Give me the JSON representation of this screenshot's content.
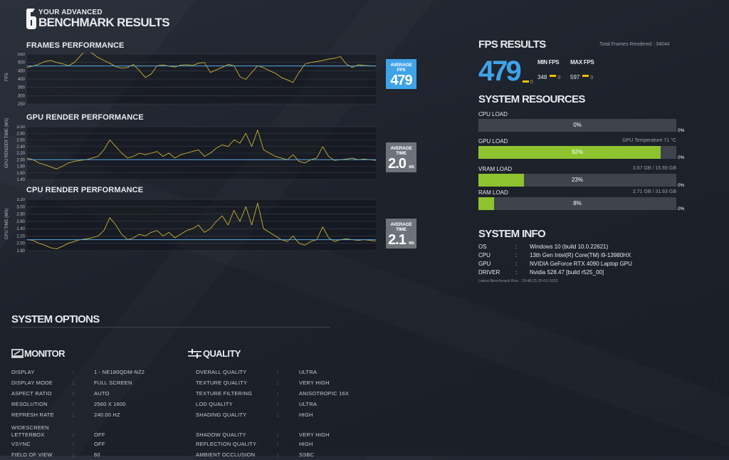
{
  "header": {
    "logo_number": "6",
    "title_line1": "YOUR ADVANCED",
    "title_line2": "BENCHMARK RESULTS"
  },
  "frames_chart": {
    "title": "FRAMES PERFORMANCE",
    "ylabel": "FPS",
    "ticks": [
      "550",
      "500",
      "450",
      "400",
      "350",
      "300",
      "250"
    ],
    "avg_label": "AVERAGE FPS",
    "avg_value": "479",
    "avg_unit": ""
  },
  "gpu_chart": {
    "title": "GPU RENDER PERFORMANCE",
    "ylabel": "GPU RENDER TIME (MS)",
    "ticks": [
      "3.00",
      "2.80",
      "2.60",
      "2.40",
      "2.20",
      "2.00",
      "1.80",
      "1.60",
      "1.40"
    ],
    "avg_label": "AVERAGE TIME",
    "avg_value": "2.0",
    "avg_unit": "MS"
  },
  "cpu_chart": {
    "title": "CPU RENDER PERFORMANCE",
    "ylabel": "CPU TIME (MS)",
    "ticks": [
      "3.20",
      "3.00",
      "2.80",
      "2.60",
      "2.40",
      "2.20",
      "2.00",
      "1.80"
    ],
    "avg_label": "AVERAGE TIME",
    "avg_value": "2.1",
    "avg_unit": "MS"
  },
  "chart_data": [
    {
      "type": "line",
      "title": "FRAMES PERFORMANCE",
      "ylabel": "FPS",
      "ylim": [
        250,
        550
      ],
      "x": [
        0,
        1,
        2,
        3,
        4,
        5,
        6,
        7,
        8,
        9,
        10,
        11,
        12,
        13,
        14,
        15,
        16,
        17,
        18,
        19,
        20,
        21,
        22,
        23,
        24,
        25,
        26,
        27,
        28,
        29,
        30,
        31,
        32,
        33,
        34,
        35,
        36,
        37,
        38,
        39,
        40,
        41,
        42,
        43,
        44,
        45,
        46,
        47,
        48,
        49,
        50,
        51,
        52,
        53,
        54,
        55,
        56,
        57,
        58,
        59
      ],
      "series": [
        {
          "values": [
            470,
            478,
            490,
            505,
            512,
            500,
            492,
            480,
            500,
            538,
            580,
            555,
            530,
            512,
            495,
            475,
            465,
            470,
            488,
            450,
            410,
            430,
            480,
            485,
            478,
            472,
            484,
            486,
            482,
            495,
            500,
            440,
            455,
            470,
            488,
            480,
            415,
            398,
            440,
            480,
            468,
            450,
            435,
            410,
            395,
            380,
            440,
            490,
            500,
            505,
            512,
            520,
            525,
            535,
            490,
            470,
            486,
            482,
            480,
            478
          ]
        },
        {
          "values": [
            479,
            479,
            479,
            479,
            479,
            479,
            479,
            479,
            479,
            479,
            479,
            479,
            479,
            479,
            479,
            479,
            479,
            479,
            479,
            479,
            479,
            479,
            479,
            479,
            479,
            479,
            479,
            479,
            479,
            479,
            479,
            479,
            479,
            479,
            479,
            479,
            479,
            479,
            479,
            479,
            479,
            479,
            479,
            479,
            479,
            479,
            479,
            479,
            479,
            479,
            479,
            479,
            479,
            479,
            479,
            479,
            479,
            479,
            479,
            479
          ]
        }
      ]
    },
    {
      "type": "line",
      "title": "GPU RENDER PERFORMANCE",
      "ylabel": "GPU RENDER TIME (MS)",
      "ylim": [
        1.4,
        3.0
      ],
      "x": [
        0,
        1,
        2,
        3,
        4,
        5,
        6,
        7,
        8,
        9,
        10,
        11,
        12,
        13,
        14,
        15,
        16,
        17,
        18,
        19,
        20,
        21,
        22,
        23,
        24,
        25,
        26,
        27,
        28,
        29,
        30,
        31,
        32,
        33,
        34,
        35,
        36,
        37,
        38,
        39,
        40,
        41,
        42,
        43,
        44,
        45,
        46,
        47,
        48,
        49,
        50,
        51,
        52,
        53,
        54,
        55,
        56,
        57,
        58,
        59
      ],
      "series": [
        {
          "values": [
            2.05,
            2.0,
            1.9,
            1.85,
            1.78,
            1.72,
            1.8,
            1.9,
            1.95,
            1.98,
            2.0,
            2.05,
            2.1,
            2.3,
            2.6,
            2.4,
            2.2,
            2.05,
            2.1,
            2.2,
            2.15,
            2.2,
            2.25,
            2.1,
            2.2,
            2.05,
            2.15,
            2.2,
            2.25,
            2.3,
            2.1,
            2.2,
            2.35,
            2.45,
            2.4,
            2.6,
            2.5,
            2.8,
            2.4,
            2.9,
            2.3,
            2.2,
            2.1,
            2.05,
            2.0,
            2.15,
            1.95,
            1.9,
            2.0,
            2.05,
            2.4,
            2.1,
            1.98,
            2.0,
            2.02,
            2.05,
            2.0,
            2.02,
            2.0,
            1.98
          ]
        },
        {
          "values": [
            2.0,
            2.0,
            2.0,
            2.0,
            2.0,
            2.0,
            2.0,
            2.0,
            2.0,
            2.0,
            2.0,
            2.0,
            2.0,
            2.0,
            2.0,
            2.0,
            2.0,
            2.0,
            2.0,
            2.0,
            2.0,
            2.0,
            2.0,
            2.0,
            2.0,
            2.0,
            2.0,
            2.0,
            2.0,
            2.0,
            2.0,
            2.0,
            2.0,
            2.0,
            2.0,
            2.0,
            2.0,
            2.0,
            2.0,
            2.0,
            2.0,
            2.0,
            2.0,
            2.0,
            2.0,
            2.0,
            2.0,
            2.0,
            2.0,
            2.0,
            2.0,
            2.0,
            2.0,
            2.0,
            2.0,
            2.0,
            2.0,
            2.0,
            2.0,
            2.0
          ]
        }
      ]
    },
    {
      "type": "line",
      "title": "CPU RENDER PERFORMANCE",
      "ylabel": "CPU TIME (MS)",
      "ylim": [
        1.8,
        3.2
      ],
      "x": [
        0,
        1,
        2,
        3,
        4,
        5,
        6,
        7,
        8,
        9,
        10,
        11,
        12,
        13,
        14,
        15,
        16,
        17,
        18,
        19,
        20,
        21,
        22,
        23,
        24,
        25,
        26,
        27,
        28,
        29,
        30,
        31,
        32,
        33,
        34,
        35,
        36,
        37,
        38,
        39,
        40,
        41,
        42,
        43,
        44,
        45,
        46,
        47,
        48,
        49,
        50,
        51,
        52,
        53,
        54,
        55,
        56,
        57,
        58,
        59
      ],
      "series": [
        {
          "values": [
            2.1,
            2.08,
            2.0,
            1.95,
            1.88,
            1.85,
            1.92,
            2.0,
            2.05,
            2.1,
            2.12,
            2.15,
            2.2,
            2.35,
            2.7,
            2.5,
            2.25,
            2.1,
            2.15,
            2.25,
            2.2,
            2.3,
            2.35,
            2.2,
            2.3,
            2.15,
            2.25,
            2.35,
            2.4,
            2.5,
            2.3,
            2.4,
            2.6,
            2.75,
            2.5,
            2.9,
            2.6,
            3.0,
            2.5,
            3.1,
            2.4,
            2.3,
            2.2,
            2.1,
            2.05,
            2.2,
            2.0,
            1.95,
            2.05,
            2.1,
            2.45,
            2.15,
            2.05,
            2.1,
            2.12,
            2.1,
            2.08,
            2.1,
            2.08,
            2.06
          ]
        },
        {
          "values": [
            2.1,
            2.1,
            2.1,
            2.1,
            2.1,
            2.1,
            2.1,
            2.1,
            2.1,
            2.1,
            2.1,
            2.1,
            2.1,
            2.1,
            2.1,
            2.1,
            2.1,
            2.1,
            2.1,
            2.1,
            2.1,
            2.1,
            2.1,
            2.1,
            2.1,
            2.1,
            2.1,
            2.1,
            2.1,
            2.1,
            2.1,
            2.1,
            2.1,
            2.1,
            2.1,
            2.1,
            2.1,
            2.1,
            2.1,
            2.1,
            2.1,
            2.1,
            2.1,
            2.1,
            2.1,
            2.1,
            2.1,
            2.1,
            2.1,
            2.1,
            2.1,
            2.1,
            2.1,
            2.1,
            2.1,
            2.1,
            2.1,
            2.1,
            2.1,
            2.1
          ]
        }
      ]
    }
  ],
  "fps_results": {
    "title": "FPS RESULTS",
    "total_frames": "Total Frames Rendered : 34044",
    "avg": "479",
    "avg_sub": "0",
    "min_label": "MIN FPS",
    "min_value": "348",
    "min_sub": "0",
    "max_label": "MAX FPS",
    "max_value": "597",
    "max_sub": "0"
  },
  "resources": {
    "title": "SYSTEM RESOURCES",
    "items": [
      {
        "label": "CPU LOAD",
        "right": "",
        "fill": 0,
        "pct": "0%",
        "side": "0%"
      },
      {
        "label": "GPU LOAD",
        "right": "GPU Temperature 71 °C",
        "fill": 0.92,
        "pct": "92%",
        "side": "0%"
      },
      {
        "label": "VRAM LOAD",
        "right": "3.67 GB / 15.69 GB",
        "fill": 0.23,
        "pct": "23%",
        "side": "0%"
      },
      {
        "label": "RAM LOAD",
        "right": "2.71 GB / 31.63 GB",
        "fill": 0.08,
        "pct": "8%",
        "side": "0%"
      }
    ]
  },
  "system_info": {
    "title": "SYSTEM INFO",
    "rows": [
      {
        "k": "OS",
        "v": "Windows 10 (build 10.0.22621)"
      },
      {
        "k": "CPU",
        "v": "13th Gen Intel(R) Core(TM) i9-13980HX"
      },
      {
        "k": "GPU",
        "v": "NVIDIA GeForce RTX 4090 Laptop GPU"
      },
      {
        "k": "DRIVER",
        "v": "Nvidia 528.47 [build r525_00]"
      }
    ],
    "separator": ":",
    "latest_run": "Latest Benchmark Run : 19:48:23 20-02-2023"
  },
  "system_options": {
    "title": "SYSTEM OPTIONS",
    "monitor": {
      "title": "MONITOR",
      "rows": [
        {
          "k": "DISPLAY",
          "v": "1 - NE180QDM-NZ2"
        },
        {
          "k": "DISPLAY MODE",
          "v": "FULL SCREEN"
        },
        {
          "k": "ASPECT RATIO",
          "v": "AUTO"
        },
        {
          "k": "RESOLUTION",
          "v": "2560 X 1600"
        },
        {
          "k": "REFRESH RATE",
          "v": "240.00 HZ"
        },
        {
          "k": "WIDESCREEN LETTERBOX",
          "v": "OFF"
        },
        {
          "k": "VSYNC",
          "v": "OFF"
        },
        {
          "k": "FIELD OF VIEW",
          "v": "60"
        }
      ]
    },
    "quality": {
      "title": "QUALITY",
      "rows": [
        {
          "k": "OVERALL QUALITY",
          "v": "ULTRA"
        },
        {
          "k": "TEXTURE QUALITY",
          "v": "VERY HIGH"
        },
        {
          "k": "TEXTURE FILTERING",
          "v": "ANISOTROPIC 16X"
        },
        {
          "k": "LOD QUALITY",
          "v": "ULTRA"
        },
        {
          "k": "SHADING QUALITY",
          "v": "HIGH"
        },
        {
          "k": "SHADOW QUALITY",
          "v": "VERY HIGH"
        },
        {
          "k": "REFLECTION QUALITY",
          "v": "HIGH"
        },
        {
          "k": "AMBIENT OCCLUSION",
          "v": "SSBC"
        }
      ]
    }
  },
  "colors": {
    "accent_blue": "#3fa3e8",
    "line_yellow": "#c9b234",
    "avg_line": "#5aa9e6",
    "bar_green": "#8dc32f",
    "gray_box": "#6e737b"
  }
}
